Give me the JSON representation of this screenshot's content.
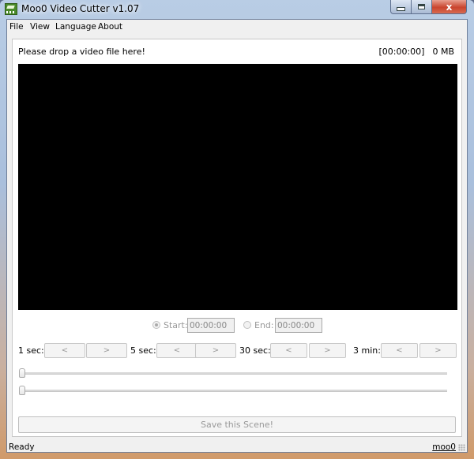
{
  "window": {
    "title": "Moo0 Video Cutter v1.07",
    "icon": "app-film-icon",
    "controls": {
      "minimize": "minimize-icon",
      "maximize": "maximize-icon",
      "close_label": "x"
    }
  },
  "menu": {
    "items": [
      {
        "label": "File"
      },
      {
        "label": "View"
      },
      {
        "label": "Language"
      },
      {
        "label": "About"
      }
    ]
  },
  "header": {
    "drop_hint": "Please drop a video file here!",
    "duration": "[00:00:00]",
    "size": "0 MB"
  },
  "range": {
    "start_label": "Start:",
    "start_value": "00:00:00",
    "start_selected": true,
    "end_label": "End:",
    "end_value": "00:00:00",
    "end_selected": false
  },
  "steps": [
    {
      "label": "1 sec:",
      "back": "<",
      "forward": ">"
    },
    {
      "label": "5 sec:",
      "back": "<",
      "forward": ">"
    },
    {
      "label": "30 sec:",
      "back": "<",
      "forward": ">"
    },
    {
      "label": "3 min:",
      "back": "<",
      "forward": ">"
    }
  ],
  "sliders": {
    "start_position": 0,
    "end_position": 0
  },
  "save_button": "Save this Scene!",
  "status": {
    "text": "Ready",
    "link": "moo0"
  }
}
